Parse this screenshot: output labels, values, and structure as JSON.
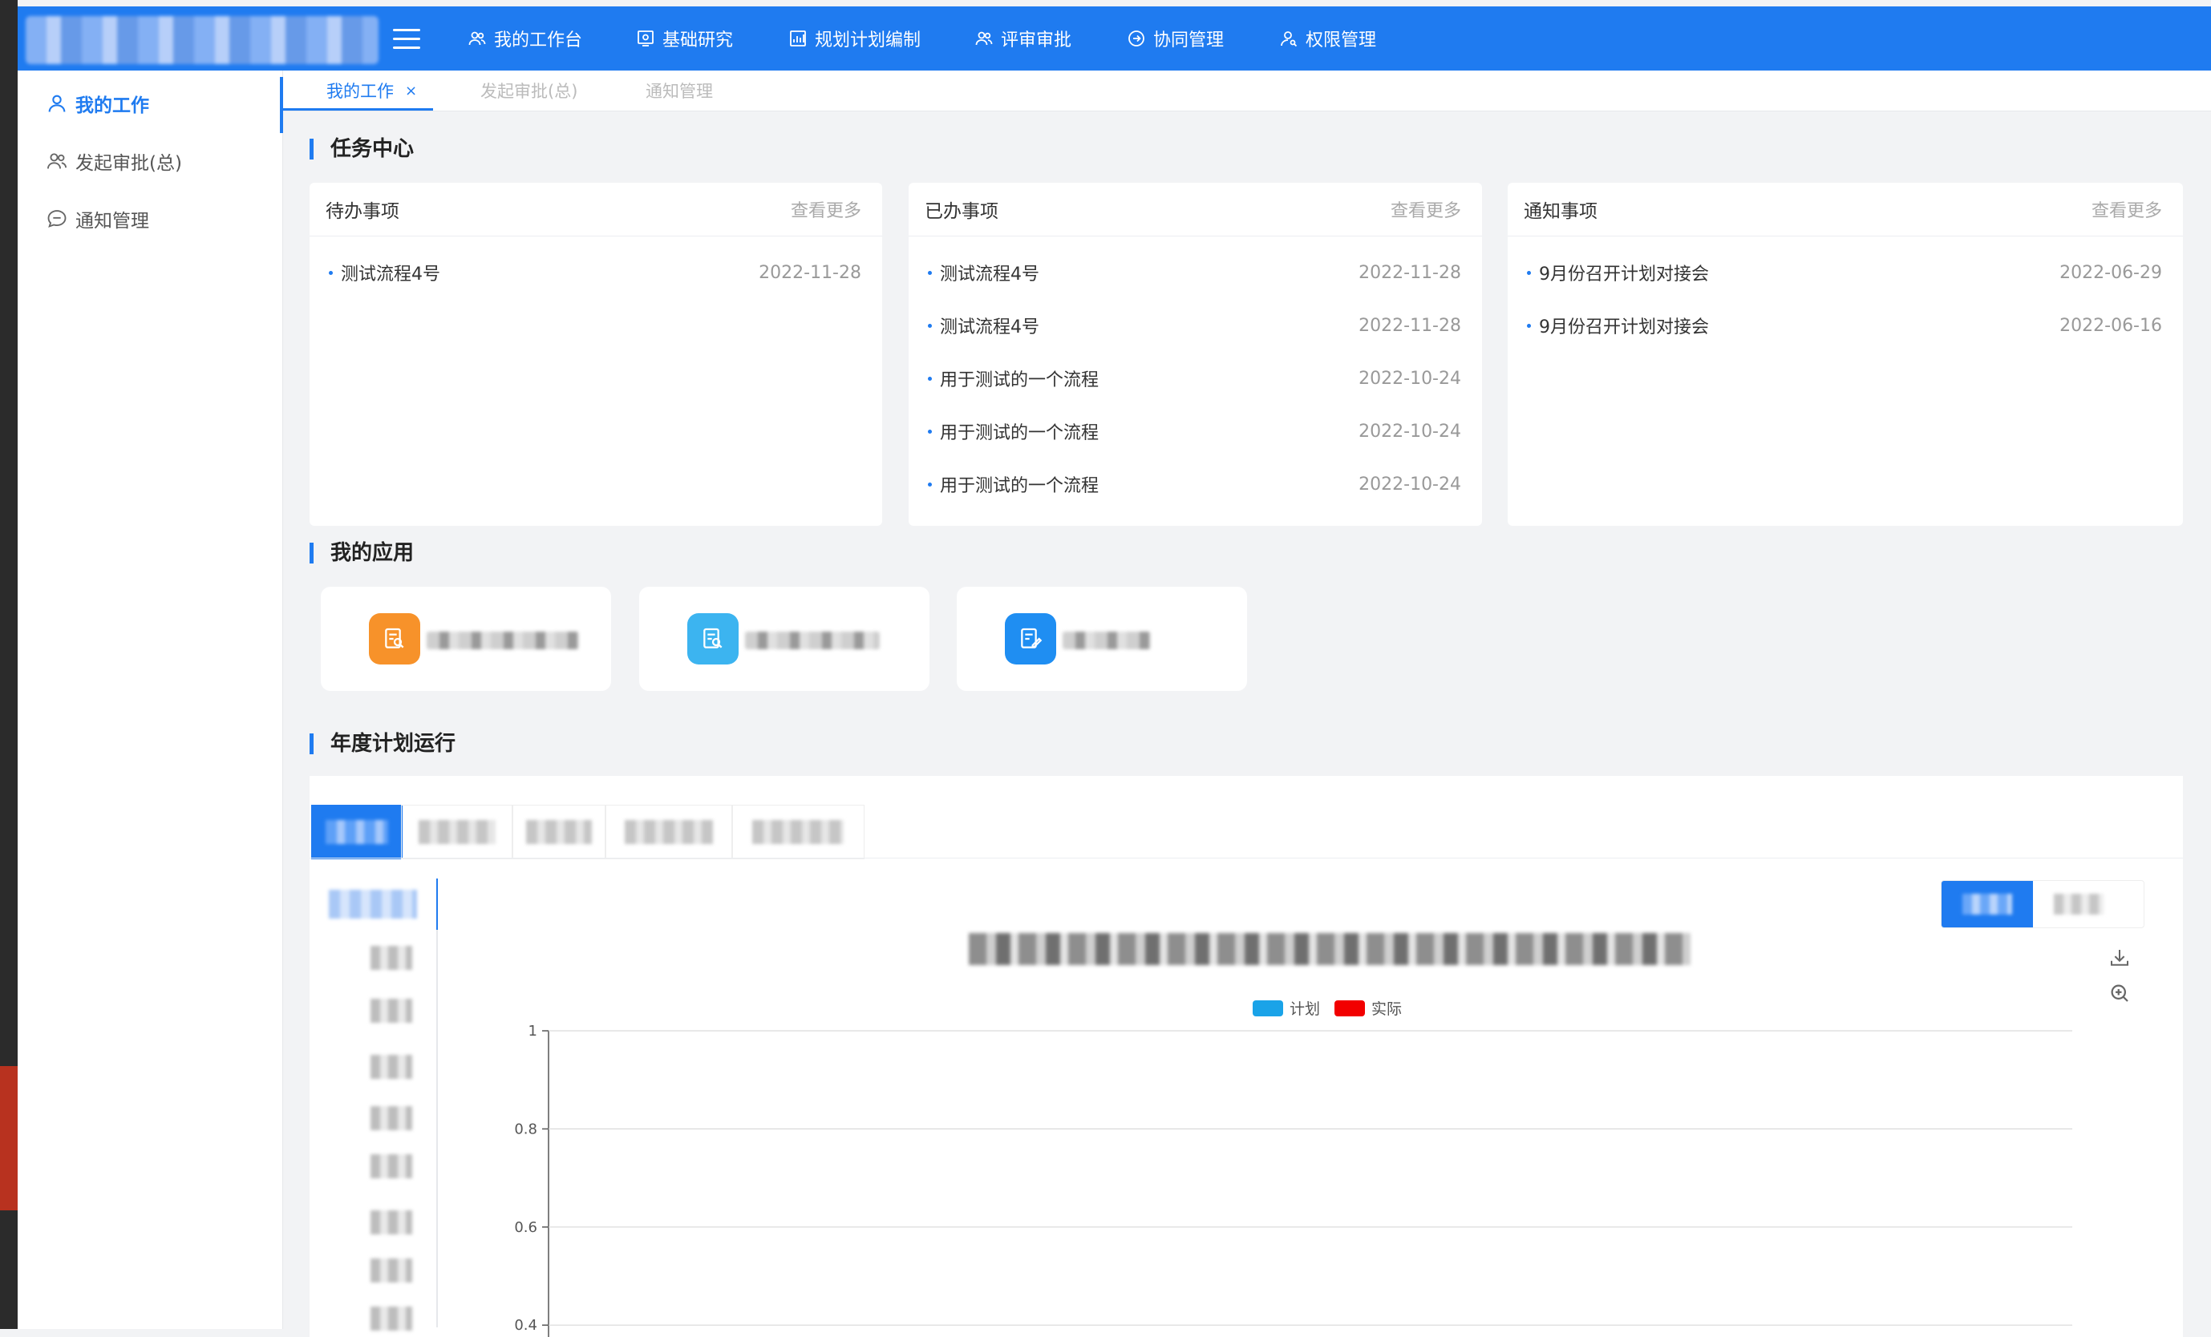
{
  "nav": {
    "items": [
      {
        "label": "我的工作台",
        "icon": "users-icon"
      },
      {
        "label": "基础研究",
        "icon": "monitor-icon"
      },
      {
        "label": "规划计划编制",
        "icon": "bar-chart-icon"
      },
      {
        "label": "评审审批",
        "icon": "users-icon"
      },
      {
        "label": "协同管理",
        "icon": "circle-arrow-icon"
      },
      {
        "label": "权限管理",
        "icon": "user-key-icon"
      }
    ]
  },
  "sidebar": {
    "items": [
      {
        "label": "我的工作",
        "icon": "user-icon",
        "active": true
      },
      {
        "label": "发起审批(总)",
        "icon": "users-icon",
        "active": false
      },
      {
        "label": "通知管理",
        "icon": "message-icon",
        "active": false
      }
    ]
  },
  "tabs": [
    {
      "label": "我的工作",
      "close": "×",
      "active": true
    },
    {
      "label": "发起审批(总)",
      "active": false
    },
    {
      "label": "通知管理",
      "active": false
    }
  ],
  "sections": {
    "task_center": "任务中心",
    "my_apps": "我的应用",
    "annual_plan": "年度计划运行"
  },
  "cards": [
    {
      "title": "待办事项",
      "more": "查看更多",
      "rows": [
        {
          "name": "测试流程4号",
          "date": "2022-11-28"
        }
      ]
    },
    {
      "title": "已办事项",
      "more": "查看更多",
      "rows": [
        {
          "name": "测试流程4号",
          "date": "2022-11-28"
        },
        {
          "name": "测试流程4号",
          "date": "2022-11-28"
        },
        {
          "name": "用于测试的一个流程",
          "date": "2022-10-24"
        },
        {
          "name": "用于测试的一个流程",
          "date": "2022-10-24"
        },
        {
          "name": "用于测试的一个流程",
          "date": "2022-10-24"
        }
      ]
    },
    {
      "title": "通知事项",
      "more": "查看更多",
      "rows": [
        {
          "name": "9月份召开计划对接会",
          "date": "2022-06-29"
        },
        {
          "name": "9月份召开计划对接会",
          "date": "2022-06-16"
        }
      ]
    }
  ],
  "apps": [
    {
      "icon": "document-search-icon",
      "color": "#f7922a"
    },
    {
      "icon": "document-search-icon",
      "color": "#3cb4f0"
    },
    {
      "icon": "document-edit-icon",
      "color": "#1f8ef2"
    }
  ],
  "colors": {
    "primary": "#1f7bf0",
    "plan": "#1aa3e8",
    "actual": "#f20000"
  },
  "chart_data": {
    "type": "bar",
    "series": [
      {
        "name": "计划",
        "values": []
      },
      {
        "name": "实际",
        "values": []
      }
    ],
    "y_ticks": [
      "1",
      "0.8",
      "0.6",
      "0.4"
    ],
    "ylim": [
      0.4,
      1
    ],
    "grid": true,
    "legend": "top-center"
  }
}
